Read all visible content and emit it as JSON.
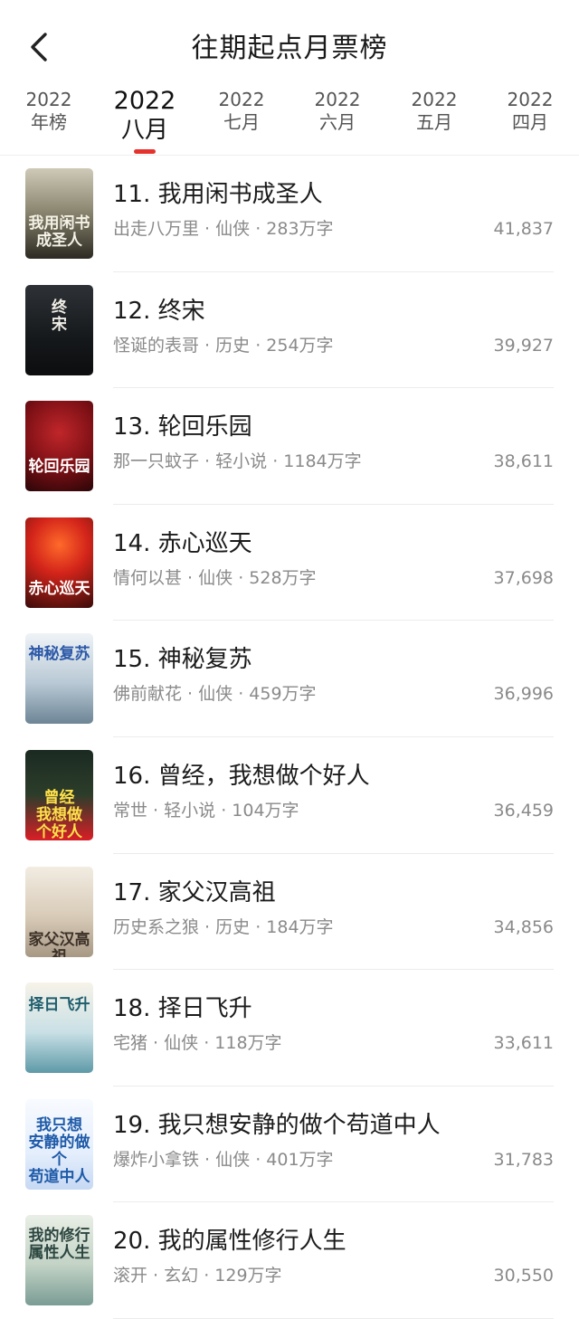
{
  "header": {
    "title": "往期起点月票榜"
  },
  "tabs": [
    {
      "year": "2022",
      "label": "年榜"
    },
    {
      "year": "2022",
      "label": "八月"
    },
    {
      "year": "2022",
      "label": "七月"
    },
    {
      "year": "2022",
      "label": "六月"
    },
    {
      "year": "2022",
      "label": "五月"
    },
    {
      "year": "2022",
      "label": "四月"
    }
  ],
  "books": [
    {
      "rank": "11.",
      "title": "我用闲书成圣人",
      "author": "出走八万里",
      "genre": "仙侠",
      "words": "283万字",
      "votes": "41,837",
      "cover_text": "我用闲书\n成圣人"
    },
    {
      "rank": "12.",
      "title": "终宋",
      "author": "怪诞的表哥",
      "genre": "历史",
      "words": "254万字",
      "votes": "39,927",
      "cover_text": "终\n宋"
    },
    {
      "rank": "13.",
      "title": "轮回乐园",
      "author": "那一只蚊子",
      "genre": "轻小说",
      "words": "1184万字",
      "votes": "38,611",
      "cover_text": "轮回乐园"
    },
    {
      "rank": "14.",
      "title": "赤心巡天",
      "author": "情何以甚",
      "genre": "仙侠",
      "words": "528万字",
      "votes": "37,698",
      "cover_text": "赤心巡天"
    },
    {
      "rank": "15.",
      "title": "神秘复苏",
      "author": "佛前献花",
      "genre": "仙侠",
      "words": "459万字",
      "votes": "36,996",
      "cover_text": "神秘复苏"
    },
    {
      "rank": "16.",
      "title": "曾经，我想做个好人",
      "author": "常世",
      "genre": "轻小说",
      "words": "104万字",
      "votes": "36,459",
      "cover_text": "曾经\n我想做\n个好人"
    },
    {
      "rank": "17.",
      "title": "家父汉高祖",
      "author": "历史系之狼",
      "genre": "历史",
      "words": "184万字",
      "votes": "34,856",
      "cover_text": "家父汉高祖"
    },
    {
      "rank": "18.",
      "title": "择日飞升",
      "author": "宅猪",
      "genre": "仙侠",
      "words": "118万字",
      "votes": "33,611",
      "cover_text": "择日飞升"
    },
    {
      "rank": "19.",
      "title": "我只想安静的做个苟道中人",
      "author": "爆炸小拿铁",
      "genre": "仙侠",
      "words": "401万字",
      "votes": "31,783",
      "cover_text": "我只想\n安静的做个\n苟道中人"
    },
    {
      "rank": "20.",
      "title": "我的属性修行人生",
      "author": "滚开",
      "genre": "玄幻",
      "words": "129万字",
      "votes": "30,550",
      "cover_text": "我的修行\n属性人生"
    }
  ],
  "meta_separator": " · ",
  "active_tab_index": 1,
  "colors": {
    "accent": "#e5322d",
    "text": "#1b1b1b",
    "muted": "#8a8a8a"
  },
  "icons": {
    "back": "chevron-left-icon"
  }
}
